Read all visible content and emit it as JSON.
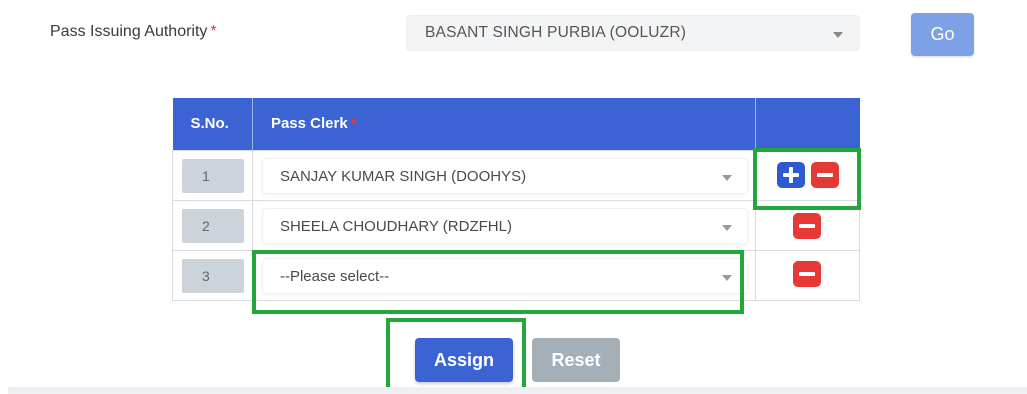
{
  "form": {
    "authority_label": "Pass Issuing Authority",
    "required_mark": "*",
    "authority_value": "BASANT SINGH PURBIA (OOLUZR)",
    "go_label": "Go"
  },
  "table": {
    "headers": {
      "sno": "S.No.",
      "clerk": "Pass Clerk",
      "action": ""
    },
    "rows": [
      {
        "sno": "1",
        "clerk": "SANJAY KUMAR SINGH (DOOHYS)",
        "actions": [
          "add-icon",
          "remove-icon"
        ]
      },
      {
        "sno": "2",
        "clerk": "SHEELA CHOUDHARY (RDZFHL)",
        "actions": [
          "remove-icon"
        ]
      },
      {
        "sno": "3",
        "clerk": "--Please select--",
        "actions": [
          "remove-icon"
        ]
      }
    ]
  },
  "buttons": {
    "assign": "Assign",
    "reset": "Reset"
  },
  "colors": {
    "primary": "#3b63d3",
    "add": "#2f59d0",
    "remove": "#e53935",
    "highlight": "#22a83a",
    "go": "#7da1e6",
    "reset": "#a4afb8"
  }
}
